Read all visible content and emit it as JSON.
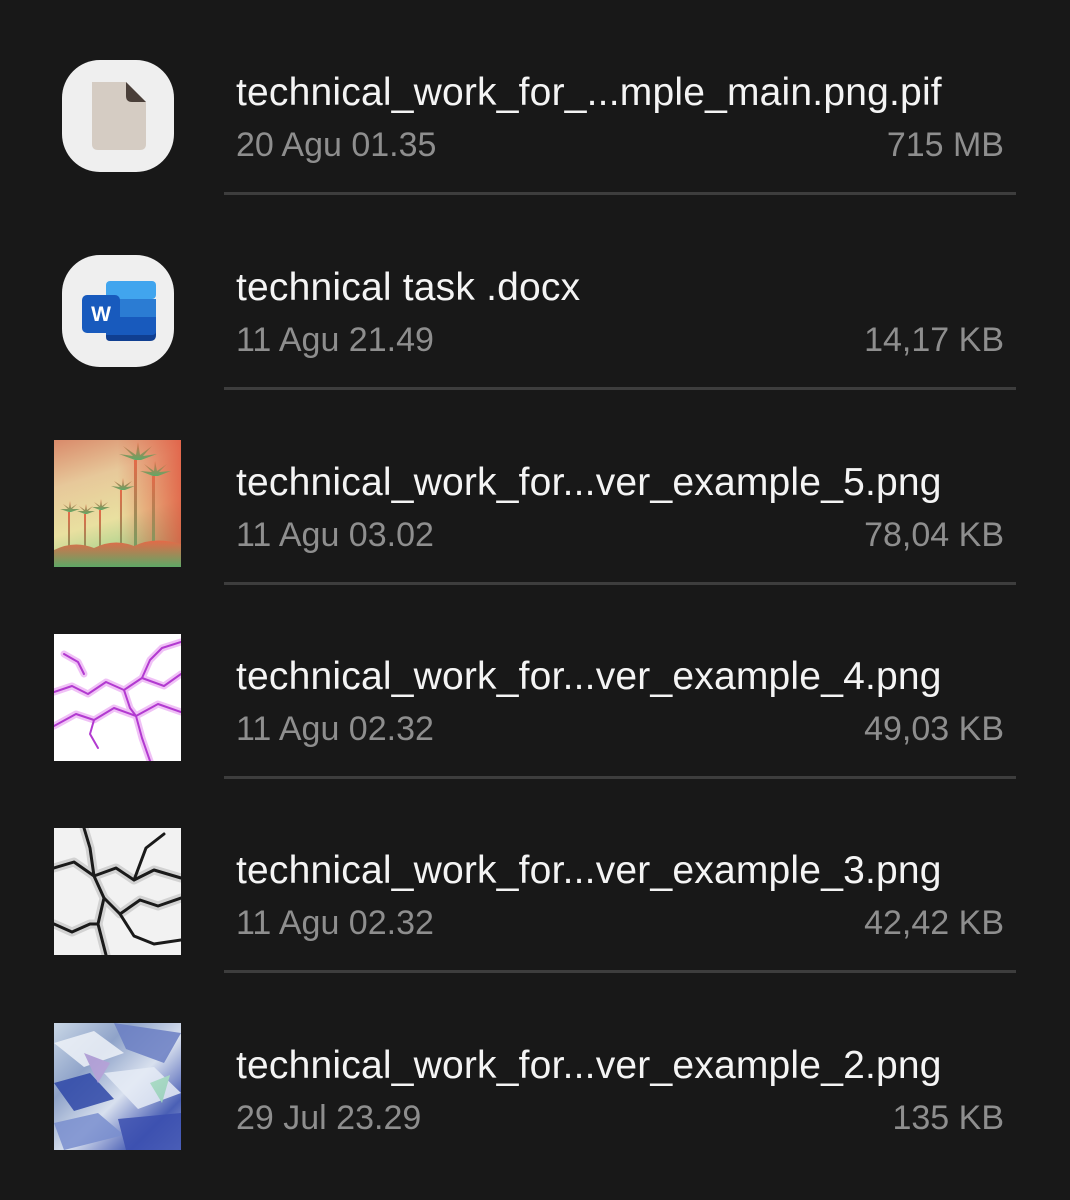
{
  "files": [
    {
      "name": "technical_work_for_...mple_main.png.pif",
      "date": "20 Agu 01.35",
      "size": "715 MB",
      "icon": "generic-file-icon"
    },
    {
      "name": "technical task .docx",
      "date": "11 Agu 21.49",
      "size": "14,17 KB",
      "icon": "word-doc-icon"
    },
    {
      "name": "technical_work_for...ver_example_5.png",
      "date": "11 Agu 03.02",
      "size": "78,04 KB",
      "icon": "image-thumbnail-palm-trees"
    },
    {
      "name": "technical_work_for...ver_example_4.png",
      "date": "11 Agu 02.32",
      "size": "49,03 KB",
      "icon": "image-thumbnail-purple-lightning"
    },
    {
      "name": "technical_work_for...ver_example_3.png",
      "date": "11 Agu 02.32",
      "size": "42,42 KB",
      "icon": "image-thumbnail-black-marble"
    },
    {
      "name": "technical_work_for...ver_example_2.png",
      "date": "29 Jul 23.29",
      "size": "135 KB",
      "icon": "image-thumbnail-holographic"
    }
  ],
  "colors": {
    "background": "#181818",
    "primary_text": "#f4f4f4",
    "secondary_text": "#8e8e8e",
    "divider": "#3d3d3d",
    "word_blue": "#185abd"
  }
}
